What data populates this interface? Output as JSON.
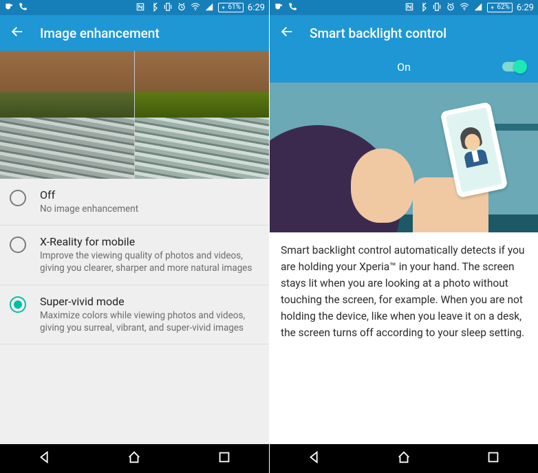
{
  "statusbar": {
    "battery_left": "61%",
    "battery_right": "62%",
    "time": "6:29"
  },
  "left": {
    "title": "Image enhancement",
    "options": [
      {
        "title": "Off",
        "desc": "No image enhancement"
      },
      {
        "title": "X-Reality for mobile",
        "desc": "Improve the viewing quality of photos and videos, giving you clearer, sharper and more natural images"
      },
      {
        "title": "Super-vivid mode",
        "desc": "Maximize colors while viewing photos and videos, giving you surreal, vibrant, and super-vivid images"
      }
    ],
    "selected_index": 2
  },
  "right": {
    "title": "Smart backlight control",
    "toggle_label": "On",
    "toggle_on": true,
    "description": "Smart backlight control automatically detects if you are holding your Xperia™ in your hand. The screen stays lit when you are looking at a photo without touching the screen, for example. When you are not holding the device, like when you leave it on a desk, the screen turns off according to your sleep setting."
  }
}
